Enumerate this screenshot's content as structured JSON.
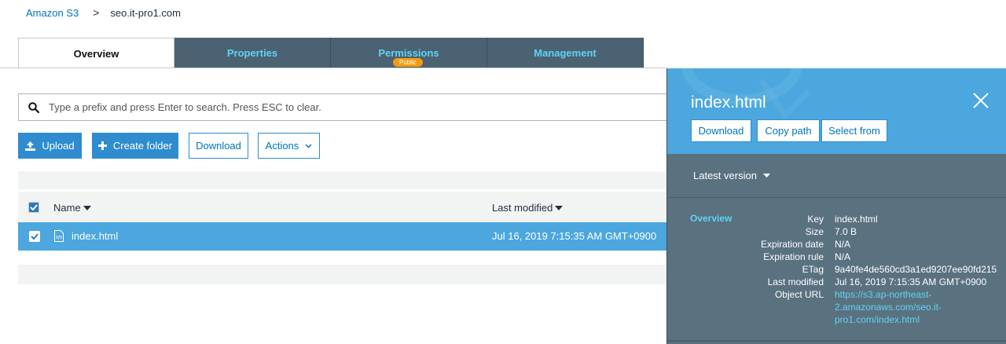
{
  "breadcrumb": {
    "root": "Amazon S3",
    "separator": ">",
    "current": "seo.it-pro1.com"
  },
  "tabs": [
    {
      "label": "Overview",
      "active": true
    },
    {
      "label": "Properties"
    },
    {
      "label": "Permissions",
      "badge": "Public"
    },
    {
      "label": "Management"
    }
  ],
  "search": {
    "placeholder": "Type a prefix and press Enter to search. Press ESC to clear.",
    "icon": "search-icon"
  },
  "toolbar": {
    "upload_label": "Upload",
    "create_folder_label": "Create folder",
    "download_label": "Download",
    "actions_label": "Actions"
  },
  "table": {
    "columns": [
      "Name",
      "Last modified"
    ],
    "rows": [
      {
        "name": "index.html",
        "last_modified": "Jul 16, 2019 7:15:35 AM GMT+0900",
        "selected": true
      }
    ]
  },
  "panel": {
    "title": "index.html",
    "buttons": {
      "download": "Download",
      "copy_path": "Copy path",
      "select_from": "Select from"
    },
    "version_label": "Latest version",
    "overview_label": "Overview",
    "details": {
      "key_label": "Key",
      "key": "index.html",
      "size_label": "Size",
      "size": "7.0 B",
      "expiration_date_label": "Expiration date",
      "expiration_date": "N/A",
      "expiration_rule_label": "Expiration rule",
      "expiration_rule": "N/A",
      "etag_label": "ETag",
      "etag": "9a40fe4de560cd3a1ed9207ee90fd215",
      "last_modified_label": "Last modified",
      "last_modified": "Jul 16, 2019 7:15:35 AM GMT+0900",
      "object_url_label": "Object URL",
      "object_url_line1": "https://s3.ap-northeast-",
      "object_url_line2": "2.amazonaws.com/seo.it-",
      "object_url_line3": "pro1.com/index.html"
    }
  },
  "colors": {
    "tab_bg": "#4b6273",
    "tab_text": "#5fd4f2",
    "accent": "#2e8ccf",
    "selected_row": "#4ba7de",
    "badge": "#f39c12",
    "panel_bg": "#5a7180"
  }
}
